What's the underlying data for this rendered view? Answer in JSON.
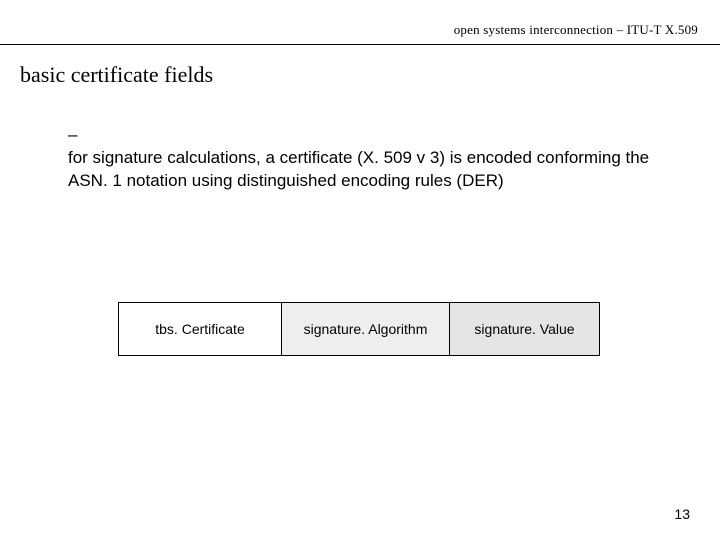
{
  "header": {
    "text": "open systems interconnection – ITU-T X.509"
  },
  "title": "basic certificate fields",
  "bullet": {
    "marker": "–",
    "text": "for signature calculations, a certificate (X. 509 v 3) is encoded conforming the ASN. 1 notation using distinguished encoding rules (DER)"
  },
  "boxes": [
    "tbs. Certificate",
    "signature. Algorithm",
    "signature. Value"
  ],
  "page_number": "13"
}
